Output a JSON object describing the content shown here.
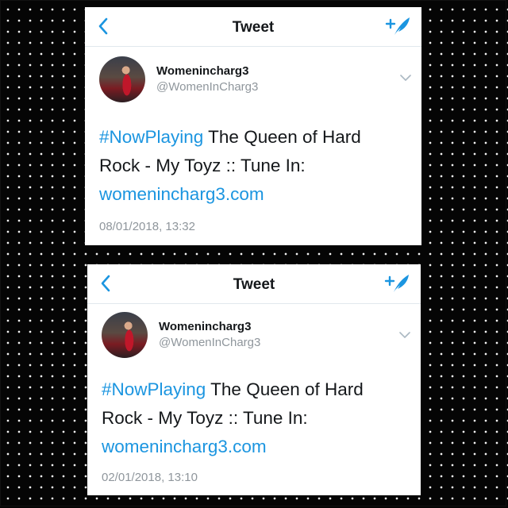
{
  "tweets": [
    {
      "nav_title": "Tweet",
      "display_name": "Womenincharg3",
      "handle": "@WomenInCharg3",
      "hashtag": "#NowPlaying",
      "text": " The Queen of Hard Rock - My Toyz :: Tune In: ",
      "link": "womenincharg3.com",
      "timestamp": "08/01/2018, 13:32"
    },
    {
      "nav_title": "Tweet",
      "display_name": "Womenincharg3",
      "handle": "@WomenInCharg3",
      "hashtag": "#NowPlaying",
      "text": " The Queen of Hard Rock - My Toyz :: Tune In: ",
      "link": "womenincharg3.com",
      "timestamp": "02/01/2018, 13:10"
    }
  ],
  "icons": {
    "back": "chevron-left-icon",
    "compose": "compose-tweet-icon",
    "more": "chevron-down-icon"
  },
  "colors": {
    "accent": "#1b95e0",
    "text": "#14171a",
    "secondary": "#8f969c",
    "background": "#050505"
  }
}
